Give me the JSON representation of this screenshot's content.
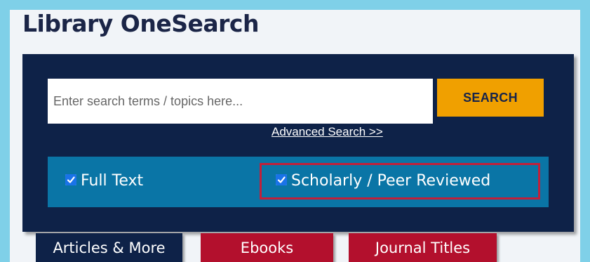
{
  "header": {
    "title": "Library OneSearch"
  },
  "search": {
    "placeholder": "Enter search terms / topics here...",
    "value": "",
    "button_label": "SEARCH",
    "advanced_link": "Advanced Search >>"
  },
  "filters": [
    {
      "label": "Full Text",
      "checked": true
    },
    {
      "label": "Scholarly / Peer Reviewed",
      "checked": true,
      "highlighted": true
    }
  ],
  "tabs": [
    {
      "label": "Articles & More",
      "active": true
    },
    {
      "label": "Ebooks",
      "active": false
    },
    {
      "label": "Journal Titles",
      "active": false
    }
  ],
  "colors": {
    "background": "#7fd0e8",
    "panel": "#f1f4f8",
    "search_box": "#0e2248",
    "search_button": "#f0a000",
    "filter_bar": "#0a75a6",
    "highlight": "#c1203a",
    "inactive_tab": "#b3102d",
    "checkbox": "#1a73e8"
  },
  "icons": [
    "checkmark-icon"
  ]
}
